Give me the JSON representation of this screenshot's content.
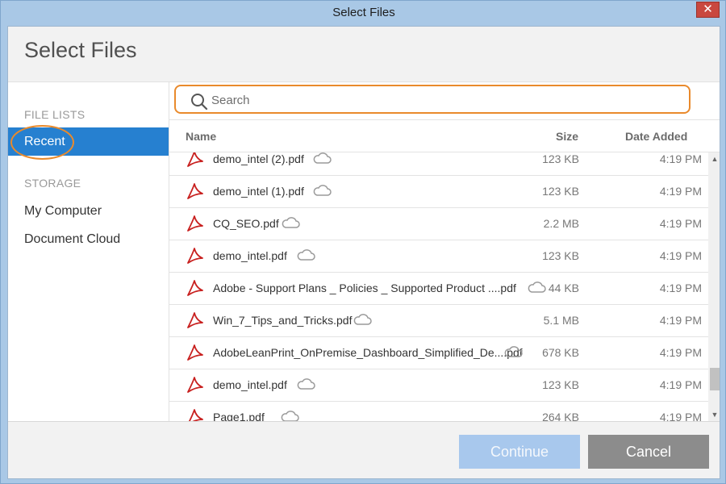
{
  "window": {
    "title": "Select Files",
    "close_glyph": "✕"
  },
  "header": {
    "title": "Select Files"
  },
  "sidebar": {
    "file_lists_label": "FILE LISTS",
    "recent_label": "Recent",
    "storage_label": "STORAGE",
    "storage_items": [
      "My Computer",
      "Document Cloud"
    ]
  },
  "search": {
    "placeholder": "Search",
    "value": ""
  },
  "columns": {
    "name": "Name",
    "size": "Size",
    "date": "Date Added"
  },
  "files": [
    {
      "name": "demo_intel (2).pdf",
      "size": "123 KB",
      "date": "4:19 PM"
    },
    {
      "name": "demo_intel (1).pdf",
      "size": "123 KB",
      "date": "4:19 PM"
    },
    {
      "name": "CQ_SEO.pdf",
      "size": "2.2 MB",
      "date": "4:19 PM"
    },
    {
      "name": "demo_intel.pdf",
      "size": "123 KB",
      "date": "4:19 PM"
    },
    {
      "name": "Adobe - Support Plans _ Policies _ Supported Product ....pdf",
      "size": "44 KB",
      "date": "4:19 PM"
    },
    {
      "name": "Win_7_Tips_and_Tricks.pdf",
      "size": "5.1 MB",
      "date": "4:19 PM"
    },
    {
      "name": "AdobeLeanPrint_OnPremise_Dashboard_Simplified_De....pdf",
      "size": "678 KB",
      "date": "4:19 PM"
    },
    {
      "name": "demo_intel.pdf",
      "size": "123 KB",
      "date": "4:19 PM"
    },
    {
      "name": "Page1.pdf",
      "size": "264 KB",
      "date": "4:19 PM"
    }
  ],
  "scroll": {
    "position": 0.92
  },
  "footer": {
    "continue_label": "Continue",
    "cancel_label": "Cancel"
  },
  "icons": {
    "file": "pdf-icon",
    "cloud": "cloud-icon",
    "search": "search-icon"
  },
  "colors": {
    "accent": "#2680d0",
    "highlight": "#e98a2c",
    "pdf": "#c8201f"
  }
}
